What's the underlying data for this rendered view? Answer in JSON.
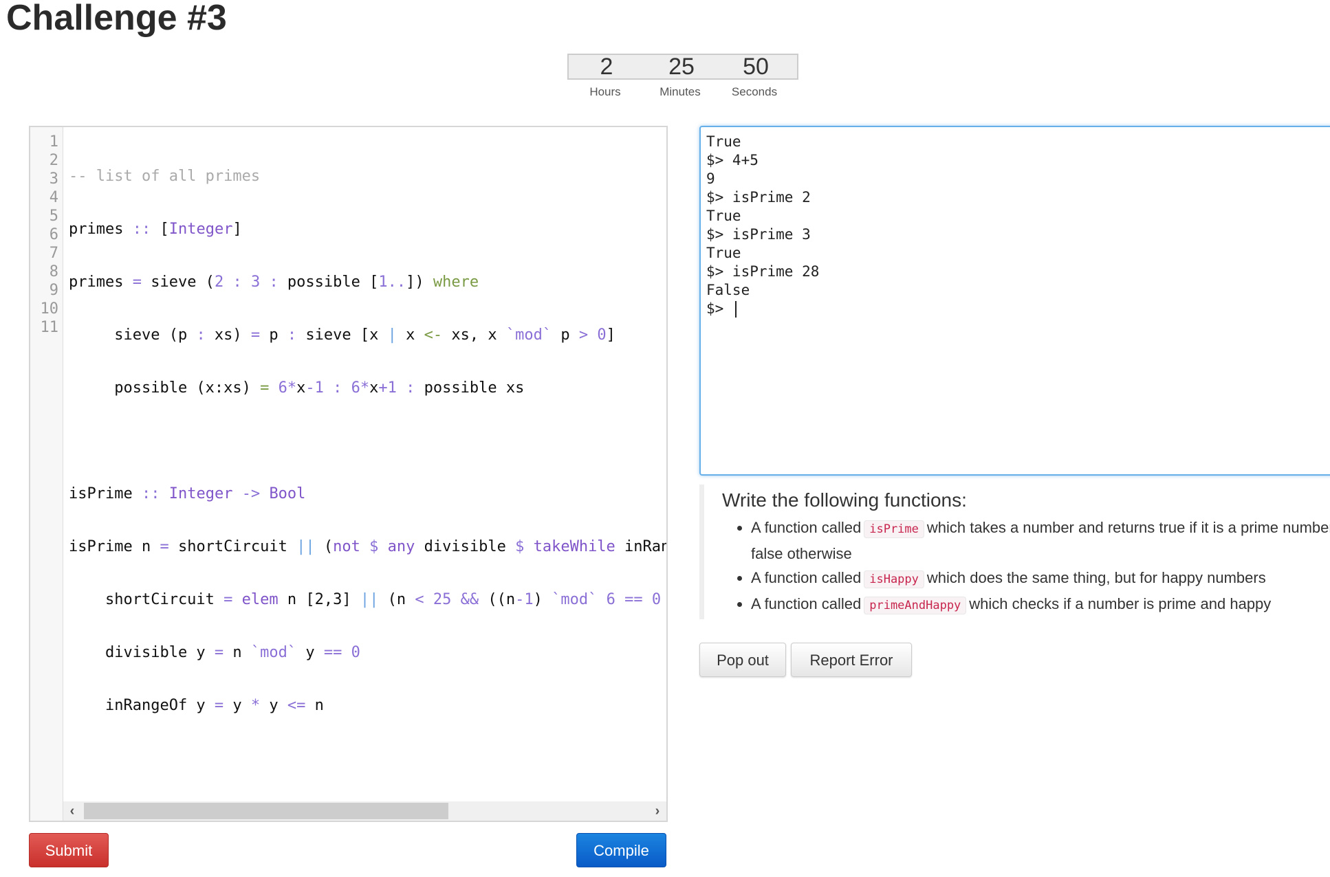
{
  "page": {
    "title": "Challenge #3"
  },
  "timer": {
    "hours": "2",
    "minutes": "25",
    "seconds": "50",
    "hours_label": "Hours",
    "minutes_label": "Minutes",
    "seconds_label": "Seconds"
  },
  "editor": {
    "line_numbers": [
      "1",
      "2",
      "3",
      "4",
      "5",
      "6",
      "7",
      "8",
      "9",
      "10",
      "11"
    ],
    "lines": [
      "-- list of all primes",
      "primes :: [Integer]",
      "primes = sieve (2 : 3 : possible [1..]) where",
      "     sieve (p : xs) = p : sieve [x | x <- xs, x `mod` p > 0]",
      "     possible (x:xs) = 6*x-1 : 6*x+1 : possible xs",
      "",
      "isPrime :: Integer -> Bool",
      "isPrime n = shortCircuit || (not $ any divisible $ takeWhile inRangeOf",
      "    shortCircuit = elem n [2,3] || (n < 25 && ((n-1) `mod` 6 == 0",
      "    divisible y = n `mod` y == 0",
      "    inRangeOf y = y * y <= n"
    ],
    "scroll_left_icon": "‹",
    "scroll_right_icon": "›"
  },
  "console": {
    "lines": [
      "True",
      "$> 4+5",
      "9",
      "$> isPrime 2",
      "True",
      "$> isPrime 3",
      "True",
      "$> isPrime 28",
      "False"
    ],
    "prompt": "$> ",
    "input_value": ""
  },
  "description": {
    "heading": "Write the following functions:",
    "items": [
      {
        "prefix": "A function called",
        "code": "isPrime",
        "suffix": "which takes a number and returns true if it is a prime number, false otherwise"
      },
      {
        "prefix": "A function called",
        "code": "isHappy",
        "suffix": "which does the same thing, but for happy numbers"
      },
      {
        "prefix": "A function called",
        "code": "primeAndHappy",
        "suffix": "which checks if a number is prime and happy"
      }
    ]
  },
  "buttons": {
    "pop_out": "Pop out",
    "report_error": "Report Error",
    "submit": "Submit",
    "compile": "Compile"
  },
  "colors": {
    "submit": "#d9534f",
    "compile": "#0d6fd8",
    "console_focus_border": "#66afe9",
    "code_highlight": "#c7254e"
  }
}
